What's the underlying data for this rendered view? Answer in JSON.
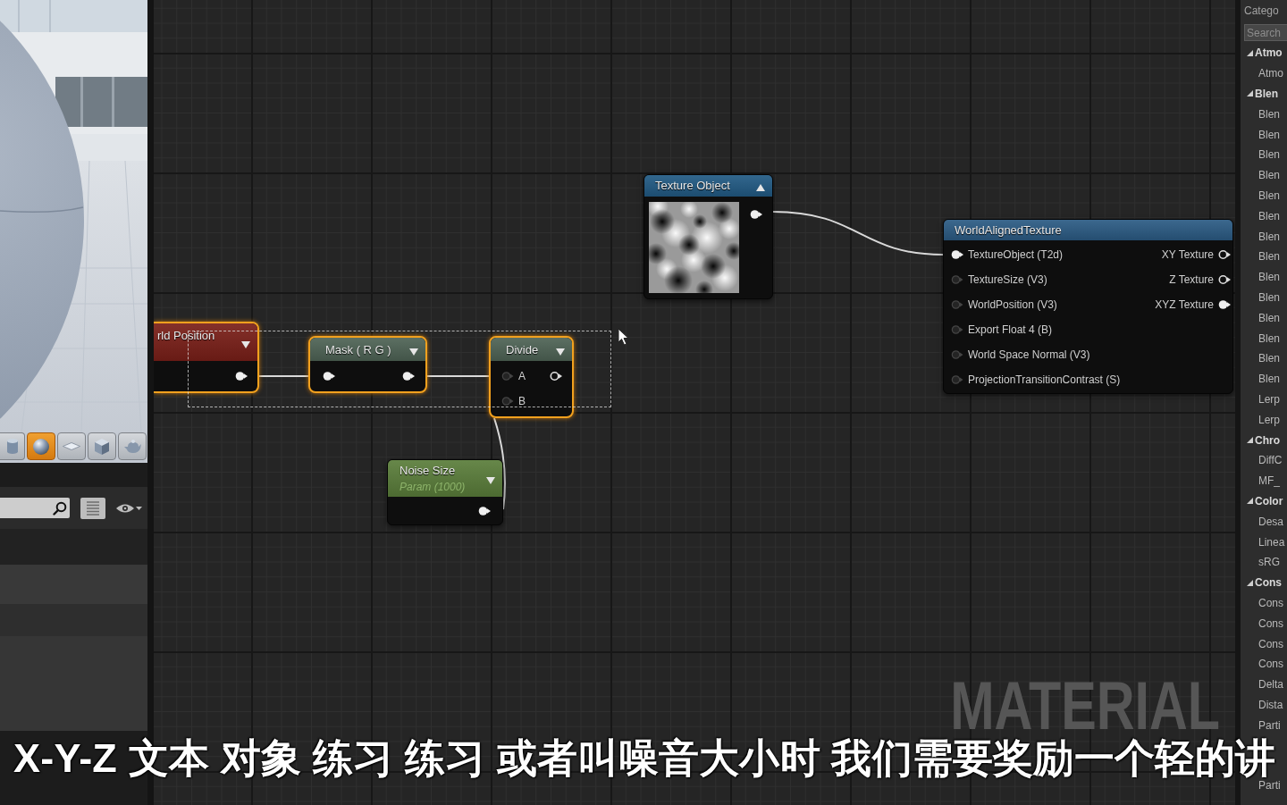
{
  "preview": {
    "shape_buttons": [
      {
        "kind": "cylinder",
        "selected": false
      },
      {
        "kind": "sphere",
        "selected": true
      },
      {
        "kind": "plane",
        "selected": false
      },
      {
        "kind": "cube",
        "selected": false
      },
      {
        "kind": "teapot",
        "selected": false
      }
    ]
  },
  "graph": {
    "nodes": [
      {
        "kind": "expression",
        "title": "rld Position",
        "color": "#7a1f18",
        "selected": true,
        "expanded": false,
        "outputs": [
          {
            "connected": true
          }
        ]
      },
      {
        "kind": "expression",
        "title": "Mask ( R G )",
        "color": "#4e6355",
        "selected": true,
        "expanded": false,
        "inputs": [
          {
            "connected": true
          }
        ],
        "outputs": [
          {
            "connected": true
          }
        ]
      },
      {
        "kind": "expression",
        "title": "Divide",
        "color": "#4e6355",
        "selected": true,
        "expanded": false,
        "inputs": [
          {
            "label": "A",
            "connected": false
          },
          {
            "label": "B",
            "connected": false
          }
        ],
        "outputs": [
          {
            "connected": false
          }
        ]
      },
      {
        "kind": "parameter",
        "title": "Noise Size",
        "subtitle": "Param (1000)",
        "color": "#5a7d3a",
        "selected": false,
        "expanded": false,
        "outputs": [
          {
            "connected": true
          }
        ]
      },
      {
        "kind": "texture",
        "title": "Texture Object",
        "color": "#215a84",
        "selected": false,
        "expanded": true,
        "outputs": [
          {
            "connected": true
          }
        ]
      },
      {
        "kind": "function",
        "title": "WorldAlignedTexture",
        "color": "#2b5b84",
        "selected": false,
        "inputs": [
          {
            "label": "TextureObject (T2d)",
            "connected": true
          },
          {
            "label": "TextureSize (V3)",
            "connected": false
          },
          {
            "label": "WorldPosition (V3)",
            "connected": false
          },
          {
            "label": "Export Float 4 (B)",
            "connected": false
          },
          {
            "label": "World Space Normal (V3)",
            "connected": false
          },
          {
            "label": "ProjectionTransitionContrast (S)",
            "connected": false
          }
        ],
        "outputs": [
          {
            "label": "XY Texture",
            "connected": false
          },
          {
            "label": "Z Texture",
            "connected": false
          },
          {
            "label": "XYZ Texture",
            "connected": true
          }
        ]
      }
    ],
    "type_label": "MATERIAL"
  },
  "palette": {
    "header": "Catego",
    "search": {
      "placeholder": "Search"
    },
    "groups": [
      {
        "label": "Atmo",
        "expanded": true,
        "items": [
          "Atmo"
        ]
      },
      {
        "label": "Blen",
        "expanded": true,
        "items": [
          "Blen",
          "Blen",
          "Blen",
          "Blen",
          "Blen",
          "Blen",
          "Blen",
          "Blen",
          "Blen",
          "Blen",
          "Blen",
          "Blen",
          "Blen",
          "Blen",
          "Lerp",
          "Lerp"
        ]
      },
      {
        "label": "Chro",
        "expanded": true,
        "items": [
          "DiffC",
          "MF_"
        ]
      },
      {
        "label": "Color",
        "expanded": true,
        "items": [
          "Desa",
          "Linea",
          "sRG"
        ]
      },
      {
        "label": "Cons",
        "expanded": true,
        "items": [
          "Cons",
          "Cons",
          "Cons",
          "Cons",
          "Delta",
          "Dista",
          "Parti"
        ]
      }
    ],
    "items_below_caption": [
      "Parti"
    ]
  },
  "caption": "X-Y-Z 文本 对象 练习 练习 或者叫噪音大小时 我们需要奖励一个轻的讲"
}
